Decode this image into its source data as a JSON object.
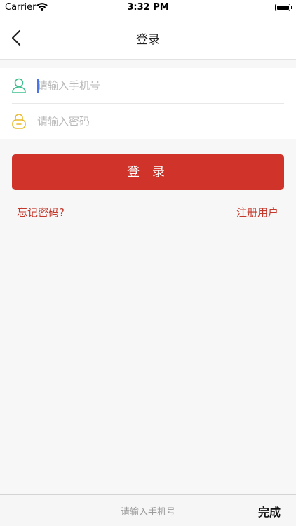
{
  "status_bar": {
    "carrier": "Carrier",
    "time": "3:32 PM"
  },
  "nav": {
    "title": "登录",
    "back_icon": "chevron-left-icon"
  },
  "form": {
    "phone": {
      "placeholder": "请输入手机号",
      "value": "",
      "icon": "user-icon",
      "icon_color": "#3fbf8f"
    },
    "password": {
      "placeholder": "请输入密码",
      "value": "",
      "icon": "lock-icon",
      "icon_color": "#e8b92a"
    }
  },
  "login_button": {
    "label": "登 录",
    "color": "#d0332a"
  },
  "links": {
    "forgot": "忘记密码?",
    "register": "注册用户",
    "color": "#c4382b"
  },
  "keyboard_toolbar": {
    "hint": "请输入手机号",
    "done": "完成"
  }
}
